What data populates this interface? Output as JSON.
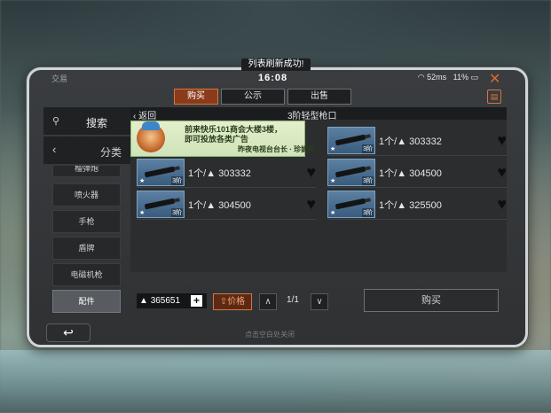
{
  "window": {
    "title": "交易",
    "toast": "列表刷新成功!",
    "clock": "16:08",
    "ping": "52ms",
    "battery": "11%"
  },
  "tabs": [
    {
      "label": "购买",
      "active": true
    },
    {
      "label": "公示",
      "active": false
    },
    {
      "label": "出售",
      "active": false
    }
  ],
  "sidebar": {
    "search_label": "搜索",
    "category_label": "分类",
    "items": [
      {
        "label": "榴弹炮",
        "partial": true
      },
      {
        "label": "喷火器"
      },
      {
        "label": "手枪"
      },
      {
        "label": "盾牌"
      },
      {
        "label": "电磁机枪"
      },
      {
        "label": "配件",
        "active": true
      }
    ]
  },
  "subheader": {
    "back_label": "返回",
    "title": "3阶轻型枪口"
  },
  "ad": {
    "line1": "前来快乐101商会大楼3楼，",
    "line2": "即可投放各类广告",
    "line3": "昨夜电视台台长 · 珍妮特"
  },
  "listings": [
    {
      "text": "1个/",
      "price": "303332",
      "tier": "3阶"
    },
    {
      "text": "1个/",
      "price": "303332",
      "tier": "3阶"
    },
    {
      "text": "1个/",
      "price": "304500",
      "tier": "3阶"
    },
    {
      "text": "1个/",
      "price": "304500",
      "tier": "3阶"
    },
    {
      "text": "1个/",
      "price": "325500",
      "tier": "3阶"
    }
  ],
  "bottom": {
    "currency": "365651",
    "price_sort": "价格",
    "page": "1/1",
    "buy_label": "购买",
    "hint": "点击空白处关闭"
  }
}
